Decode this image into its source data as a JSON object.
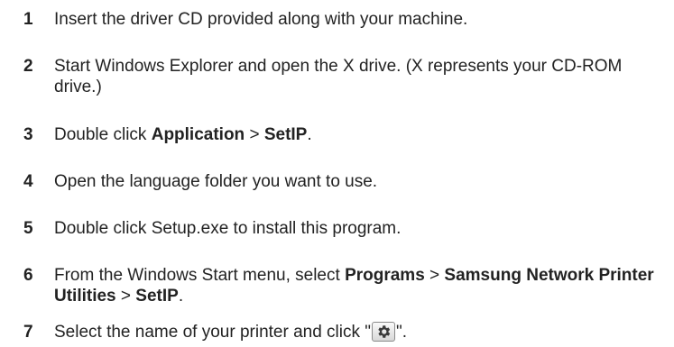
{
  "steps": [
    {
      "number": "1",
      "parts": [
        "Insert the driver CD provided along with your machine."
      ]
    },
    {
      "number": "2",
      "parts": [
        "Start Windows Explorer and open the X drive. (X represents your CD-ROM drive.)"
      ]
    },
    {
      "number": "3",
      "parts": [
        "Double click ",
        "Application",
        " > ",
        "SetIP",
        "."
      ]
    },
    {
      "number": "4",
      "parts": [
        "Open the language folder you want to use."
      ]
    },
    {
      "number": "5",
      "parts": [
        "Double click Setup.exe to install this program."
      ]
    },
    {
      "number": "6",
      "parts": [
        "From the Windows Start menu, select ",
        "Programs",
        " > ",
        "Samsung Network Printer Utilities",
        " > ",
        "SetIP",
        "."
      ]
    },
    {
      "number": "7",
      "parts": [
        "Select the name of your printer and click \"",
        "\"."
      ]
    }
  ],
  "icons": {
    "settings_button": "gear-icon"
  }
}
